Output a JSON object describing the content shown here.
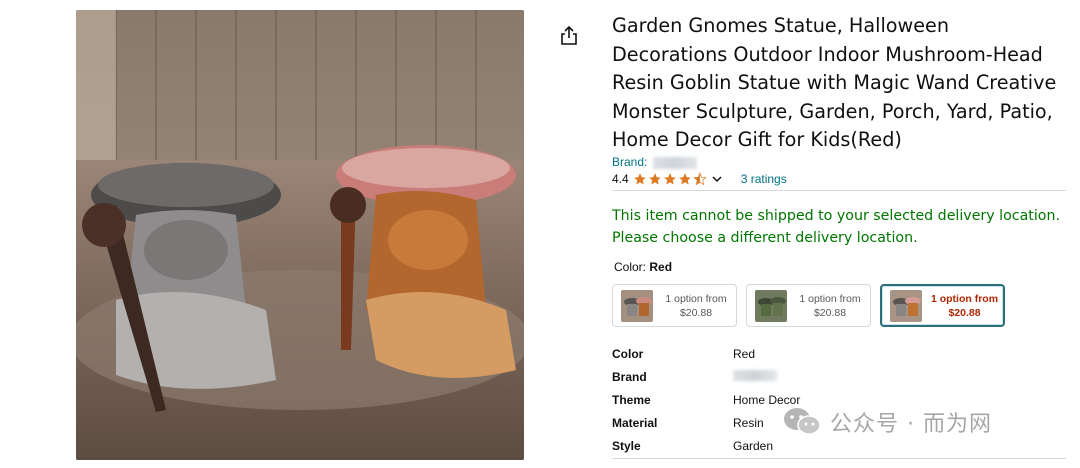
{
  "product": {
    "title_lines": [
      "Garden Gnomes Statue, Halloween",
      "Decorations Outdoor Indoor Mushroom-Head",
      "Resin Goblin Statue with Magic Wand Creative",
      "Monster Sculpture, Garden, Porch, Yard, Patio,",
      "Home Decor Gift for Kids(Red)"
    ],
    "brand_label": "Brand:",
    "rating_value": "4.4",
    "ratings_count": "3 ratings",
    "star_count": 4.4
  },
  "delivery": {
    "warning_line1": "This item cannot be shipped to your selected delivery location.",
    "warning_line2": "Please choose a different delivery location."
  },
  "color": {
    "label": "Color:",
    "selected": "Red",
    "options": [
      {
        "line1": "1 option from",
        "line2": "$20.88"
      },
      {
        "line1": "1 option from",
        "line2": "$20.88"
      },
      {
        "line1": "1 option from",
        "line2": "$20.88"
      }
    ]
  },
  "specs": [
    {
      "key": "Color",
      "value": "Red"
    },
    {
      "key": "Brand",
      "value": ""
    },
    {
      "key": "Theme",
      "value": "Home Decor"
    },
    {
      "key": "Material",
      "value": "Resin"
    },
    {
      "key": "Style",
      "value": "Garden"
    }
  ],
  "watermark": {
    "text": "公众号 · 而为网"
  },
  "icons": {
    "share": "share-icon",
    "chevron": "chevron-down-icon",
    "star": "star-icon"
  },
  "colors": {
    "link": "#007185",
    "success": "#007600",
    "price": "#b12704",
    "star": "#de7921",
    "selected_border": "#2a6f7a"
  }
}
